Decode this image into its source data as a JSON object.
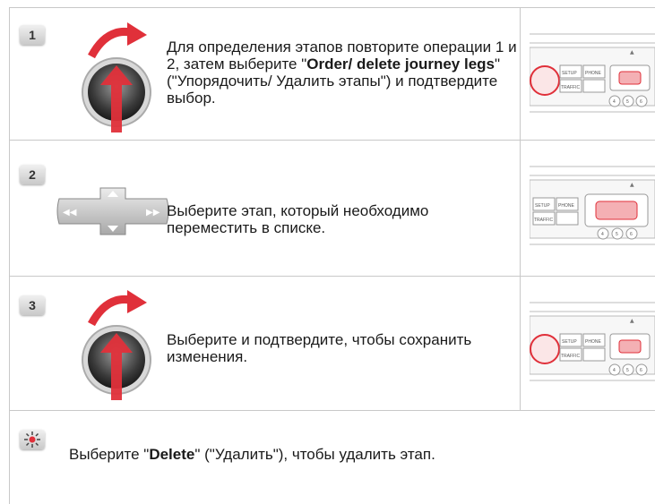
{
  "steps": [
    {
      "number": "1",
      "control": "knob-rotate-press",
      "text_parts": [
        {
          "t": "Для определения этапов повторите операции 1 и 2, затем выберите \"",
          "b": false
        },
        {
          "t": "Order/ delete journey legs",
          "b": true
        },
        {
          "t": "\" (\"Упорядочить/ Удалить этапы\") и подтвердите выбор.",
          "b": false
        }
      ],
      "panel_highlight": "knob"
    },
    {
      "number": "2",
      "control": "directional-pad",
      "text_parts": [
        {
          "t": "Выберите этап, который необходимо переместить в списке.",
          "b": false
        }
      ],
      "panel_highlight": "dpad"
    },
    {
      "number": "3",
      "control": "knob-rotate-press",
      "text_parts": [
        {
          "t": "Выберите и подтвердите, чтобы сохранить изменения.",
          "b": false
        }
      ],
      "panel_highlight": "knob"
    }
  ],
  "tip": {
    "icon": "lightbulb-icon",
    "text_parts": [
      {
        "t": "Выберите \"",
        "b": false
      },
      {
        "t": "Delete",
        "b": true
      },
      {
        "t": "\" (\"Удалить\"), чтобы удалить этап.",
        "b": false
      }
    ]
  },
  "panel_labels": {
    "setup": "SETUP",
    "phone": "PHONE",
    "traffic": "TRAFFIC",
    "b4": "4",
    "b5": "5",
    "b6": "6"
  },
  "colors": {
    "accent": "#e0303a",
    "border": "#c8c8c8",
    "badge": "#d5d5d5"
  }
}
